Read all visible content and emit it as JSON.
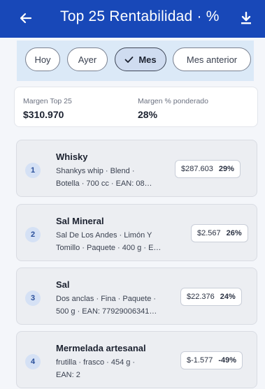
{
  "header": {
    "title": "Top 25 Rentabilidad · %",
    "back_icon": "arrow-left-icon",
    "download_icon": "download-icon",
    "bg_color": "#1848b8"
  },
  "filters": {
    "chips": [
      {
        "label": "Hoy",
        "selected": false
      },
      {
        "label": "Ayer",
        "selected": false
      },
      {
        "label": "Mes",
        "selected": true
      },
      {
        "label": "Mes anterior",
        "selected": false
      }
    ]
  },
  "summary": {
    "margin_label": "Margen Top 25",
    "margin_value": "$310.970",
    "weighted_label": "Margen % ponderado",
    "weighted_value": "28%"
  },
  "items": [
    {
      "rank": "1",
      "name": "Whisky",
      "desc_line1": "Shankys whip · Blend ·",
      "desc_line2": "Botella · 700 cc · EAN: 08…",
      "amount": "$287.603",
      "percent": "29%"
    },
    {
      "rank": "2",
      "name": "Sal Mineral",
      "desc_line1": "Sal De Los Andes · Limón Y",
      "desc_line2": "Tomillo · Paquete · 400 g · E…",
      "amount": "$2.567",
      "percent": "26%"
    },
    {
      "rank": "3",
      "name": "Sal",
      "desc_line1": "Dos anclas · Fina · Paquete ·",
      "desc_line2": "500 g · EAN: 77929006341…",
      "amount": "$22.376",
      "percent": "24%"
    },
    {
      "rank": "4",
      "name": "Mermelada artesanal",
      "desc_line1": "frutilla · frasco · 454 g ·",
      "desc_line2": "EAN: 2",
      "amount": "$-1.577",
      "percent": "-49%"
    }
  ]
}
